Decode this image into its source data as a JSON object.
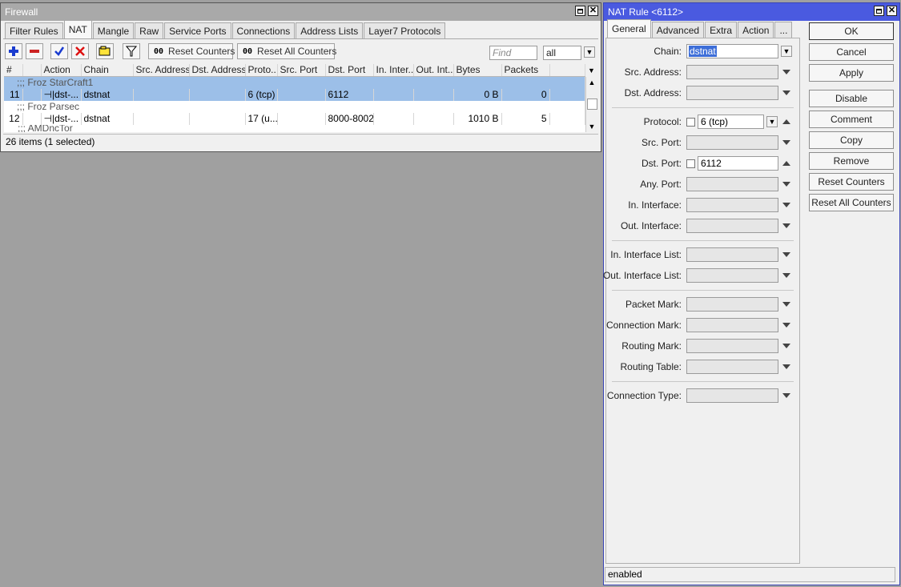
{
  "firewall": {
    "title": "Firewall",
    "tabs": [
      "Filter Rules",
      "NAT",
      "Mangle",
      "Raw",
      "Service Ports",
      "Connections",
      "Address Lists",
      "Layer7 Protocols"
    ],
    "active_tab": "NAT",
    "reset_counters": "Reset Counters",
    "reset_all_counters": "Reset All Counters",
    "counter_icon": "00",
    "find_placeholder": "Find",
    "filter_value": "all",
    "columns": [
      "#",
      "",
      "Action",
      "Chain",
      "Src. Address",
      "Dst. Address",
      "Proto...",
      "Src. Port",
      "Dst. Port",
      "In. Inter...",
      "Out. Int...",
      "Bytes",
      "Packets"
    ],
    "rows": [
      {
        "kind": "comment",
        "text": ";;; Froz StarCraft1"
      },
      {
        "kind": "rule",
        "num": "11",
        "action": "dst-...",
        "chain": "dstnat",
        "src": "",
        "dst": "",
        "proto": "6 (tcp)",
        "sport": "",
        "dport": "6112",
        "inif": "",
        "outif": "",
        "bytes": "0 B",
        "packets": "0"
      },
      {
        "kind": "comment",
        "text": ";;; Froz Parsec"
      },
      {
        "kind": "rule",
        "num": "12",
        "action": "dst-...",
        "chain": "dstnat",
        "src": "",
        "dst": "",
        "proto": "17 (u...",
        "sport": "",
        "dport": "8000-8002",
        "inif": "",
        "outif": "",
        "bytes": "1010 B",
        "packets": "5"
      },
      {
        "kind": "comment",
        "text": ";;; AMDncTor"
      }
    ],
    "status": "26 items (1 selected)"
  },
  "nat_rule": {
    "title": "NAT Rule <6112>",
    "tabs": [
      "General",
      "Advanced",
      "Extra",
      "Action",
      "..."
    ],
    "active_tab": "General",
    "fields": {
      "chain": {
        "label": "Chain:",
        "value": "dstnat"
      },
      "src_address": {
        "label": "Src. Address:",
        "value": ""
      },
      "dst_address": {
        "label": "Dst. Address:",
        "value": ""
      },
      "protocol": {
        "label": "Protocol:",
        "value": "6 (tcp)"
      },
      "src_port": {
        "label": "Src. Port:",
        "value": ""
      },
      "dst_port": {
        "label": "Dst. Port:",
        "value": "6112"
      },
      "any_port": {
        "label": "Any. Port:",
        "value": ""
      },
      "in_interface": {
        "label": "In. Interface:",
        "value": ""
      },
      "out_interface": {
        "label": "Out. Interface:",
        "value": ""
      },
      "in_interface_list": {
        "label": "In. Interface List:",
        "value": ""
      },
      "out_interface_list": {
        "label": "Out. Interface List:",
        "value": ""
      },
      "packet_mark": {
        "label": "Packet Mark:",
        "value": ""
      },
      "connection_mark": {
        "label": "Connection Mark:",
        "value": ""
      },
      "routing_mark": {
        "label": "Routing Mark:",
        "value": ""
      },
      "routing_table": {
        "label": "Routing Table:",
        "value": ""
      },
      "connection_type": {
        "label": "Connection Type:",
        "value": ""
      }
    },
    "buttons": {
      "ok": "OK",
      "cancel": "Cancel",
      "apply": "Apply",
      "disable": "Disable",
      "comment": "Comment",
      "copy": "Copy",
      "remove": "Remove",
      "reset_counters": "Reset Counters",
      "reset_all_counters": "Reset All Counters"
    },
    "status": "enabled"
  },
  "colors": {
    "active_title": "#4a5ae0",
    "inactive_title": "#a9a9a9",
    "selection": "#9cbfe8"
  }
}
